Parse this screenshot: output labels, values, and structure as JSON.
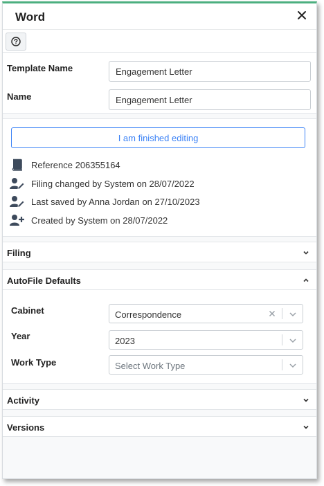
{
  "header": {
    "title": "Word"
  },
  "template": {
    "template_name_label": "Template Name",
    "template_name_value": "Engagement Letter",
    "name_label": "Name",
    "name_value": "Engagement Letter"
  },
  "status": {
    "finish_button": "I am finished editing",
    "reference": "Reference 206355164",
    "filing_changed": "Filing changed by System on 28/07/2022",
    "last_saved": "Last saved by Anna Jordan on 27/10/2023",
    "created": "Created by System on 28/07/2022"
  },
  "sections": {
    "filing": "Filing",
    "autofile": "AutoFile Defaults",
    "activity": "Activity",
    "versions": "Versions"
  },
  "autofile": {
    "cabinet_label": "Cabinet",
    "cabinet_value": "Correspondence",
    "year_label": "Year",
    "year_value": "2023",
    "work_type_label": "Work Type",
    "work_type_placeholder": "Select Work Type"
  },
  "icons": {
    "close": "close-icon",
    "help": "question-circle-icon",
    "reference": "book-icon",
    "filing": "user-edit-icon",
    "saved": "user-edit-icon",
    "created": "user-plus-icon",
    "chevron_down": "chevron-down-icon",
    "chevron_up": "chevron-up-icon",
    "clear": "clear-x-icon"
  },
  "colors": {
    "accent": "#4caf7f",
    "primary": "#3b82f6",
    "icon": "#3d4a5c"
  }
}
